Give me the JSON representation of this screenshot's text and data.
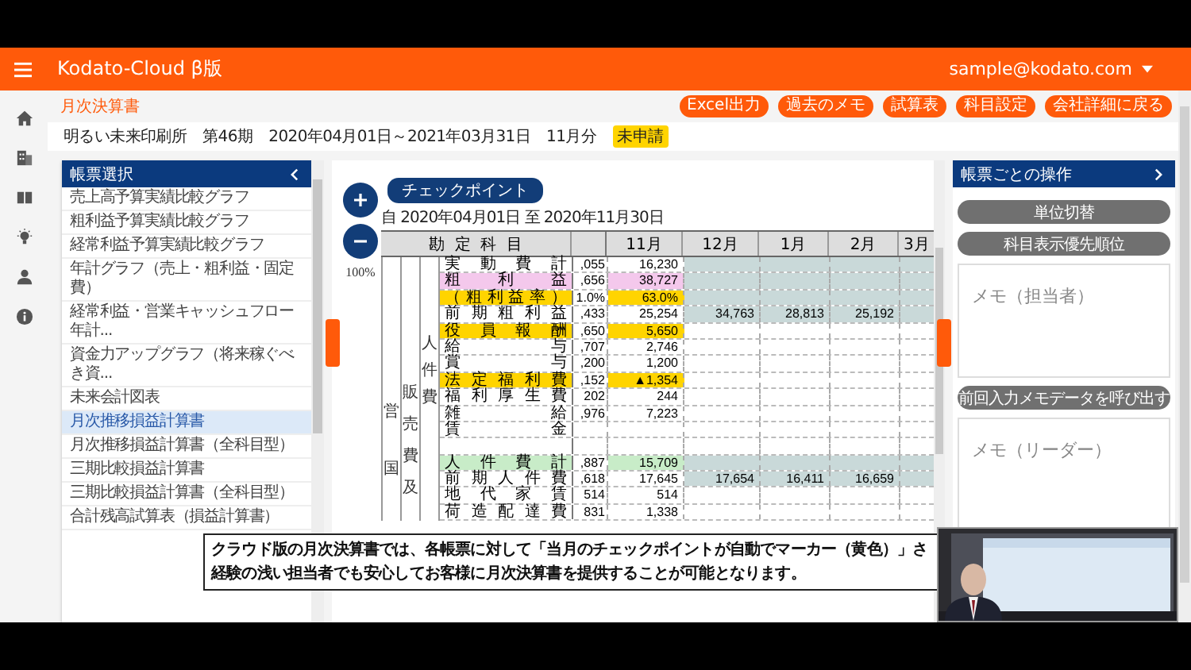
{
  "header": {
    "title": "Kodato-Cloud β版",
    "user": "sample@kodato.com"
  },
  "page": {
    "title": "月次決算書",
    "actions": [
      "Excel出力",
      "過去のメモ",
      "試算表",
      "科目設定",
      "会社詳細に戻る"
    ],
    "company": "明るい未来印刷所",
    "term": "第46期",
    "period": "2020年04月01日～2021年03月31日",
    "month": "11月分",
    "status": "未申請"
  },
  "report_list": {
    "title": "帳票選択",
    "items": [
      {
        "label": "売上高予算実績比較グラフ",
        "selected": false
      },
      {
        "label": "粗利益予算実績比較グラフ",
        "selected": false
      },
      {
        "label": "経常利益予算実績比較グラフ",
        "selected": false
      },
      {
        "label": "年計グラフ（売上・粗利益・固定費）",
        "selected": false
      },
      {
        "label": "経常利益・営業キャッシュフロー年計...",
        "selected": false
      },
      {
        "label": "資金力アップグラフ（将来稼ぐべき資...",
        "selected": false
      },
      {
        "label": "未来会計図表",
        "selected": false
      },
      {
        "label": "月次推移損益計算書",
        "selected": true
      },
      {
        "label": "月次推移損益計算書（全科目型）",
        "selected": false
      },
      {
        "label": "三期比較損益計算書",
        "selected": false
      },
      {
        "label": "三期比較損益計算書（全科目型）",
        "selected": false
      },
      {
        "label": "合計残高試算表（損益計算書）",
        "selected": false
      }
    ]
  },
  "report": {
    "checkpoint_button": "チェックポイント",
    "zoom": "100%",
    "date_range": "自 2020年04月01日 至 2020年11月30日",
    "columns": [
      "勘定科目",
      "11月",
      "12月",
      "1月",
      "2月",
      "3月"
    ],
    "groups": [
      "営国",
      "販売費及",
      "人件費"
    ],
    "rows": [
      {
        "label": "実動費計",
        "column_2": ",055",
        "values": [
          "16,230"
        ],
        "shaded": true
      },
      {
        "label": "粗利益",
        "color": "#f4c8ec",
        "column_2": ",656",
        "values": [
          "38,727"
        ],
        "shaded": true
      },
      {
        "label": "（粗利益率）",
        "color": "#ffd400",
        "column_2": "1.0%",
        "values": [
          "63.0%"
        ],
        "shaded": true
      },
      {
        "label": "前期粗利益",
        "column_2": ",433",
        "values": [
          "25,254",
          "34,763",
          "28,813",
          "25,192"
        ],
        "shaded": true
      },
      {
        "label": "役員報酬",
        "color": "#ffd400",
        "column_2": ",650",
        "values": [
          "5,650"
        ],
        "shaded": false
      },
      {
        "label": "給与",
        "column_2": ",707",
        "values": [
          "2,746"
        ],
        "shaded": false
      },
      {
        "label": "賞与",
        "column_2": ",200",
        "values": [
          "1,200"
        ],
        "shaded": false
      },
      {
        "label": "法定福利費",
        "color": "#ffd400",
        "column_2": ",152",
        "values": [
          "▲1,354"
        ],
        "shaded": false
      },
      {
        "label": "福利厚生費",
        "column_2": "202",
        "values": [
          "244"
        ],
        "shaded": false
      },
      {
        "label": "雑給",
        "column_2": ",976",
        "values": [
          "7,223"
        ],
        "shaded": false
      },
      {
        "label": "賃金",
        "shaded": false
      },
      {
        "shaded": false
      },
      {
        "label": "人件費計",
        "color": "#c8ecc8",
        "column_2": ",887",
        "values": [
          "15,709"
        ],
        "shaded": true
      },
      {
        "label": "前期人件費",
        "column_2": ",618",
        "values": [
          "17,645",
          "17,654",
          "16,411",
          "16,659"
        ],
        "shaded": true
      },
      {
        "label": "地代家賃",
        "column_2": "514",
        "values": [
          "514"
        ],
        "shaded": false
      },
      {
        "label": "荷造配達費",
        "column_2": "831",
        "values": [
          "1,338"
        ],
        "shaded": false
      }
    ]
  },
  "operations": {
    "title": "帳票ごとの操作",
    "buttons": [
      "単位切替",
      "科目表示優先順位"
    ],
    "memo_staff": {
      "placeholder": "メモ（担当者）"
    },
    "recall_button": "前回入力メモデータを呼び出す",
    "memo_leader": {
      "placeholder": "メモ（リーダー）"
    }
  },
  "subtitle": [
    "クラウド版の月次決算書では、各帳票に対して「当月のチェックポイントが自動でマーカー（黄色）」さ",
    "経験の浅い担当者でも安心してお客様に月次決算書を提供することが可能となります。"
  ]
}
